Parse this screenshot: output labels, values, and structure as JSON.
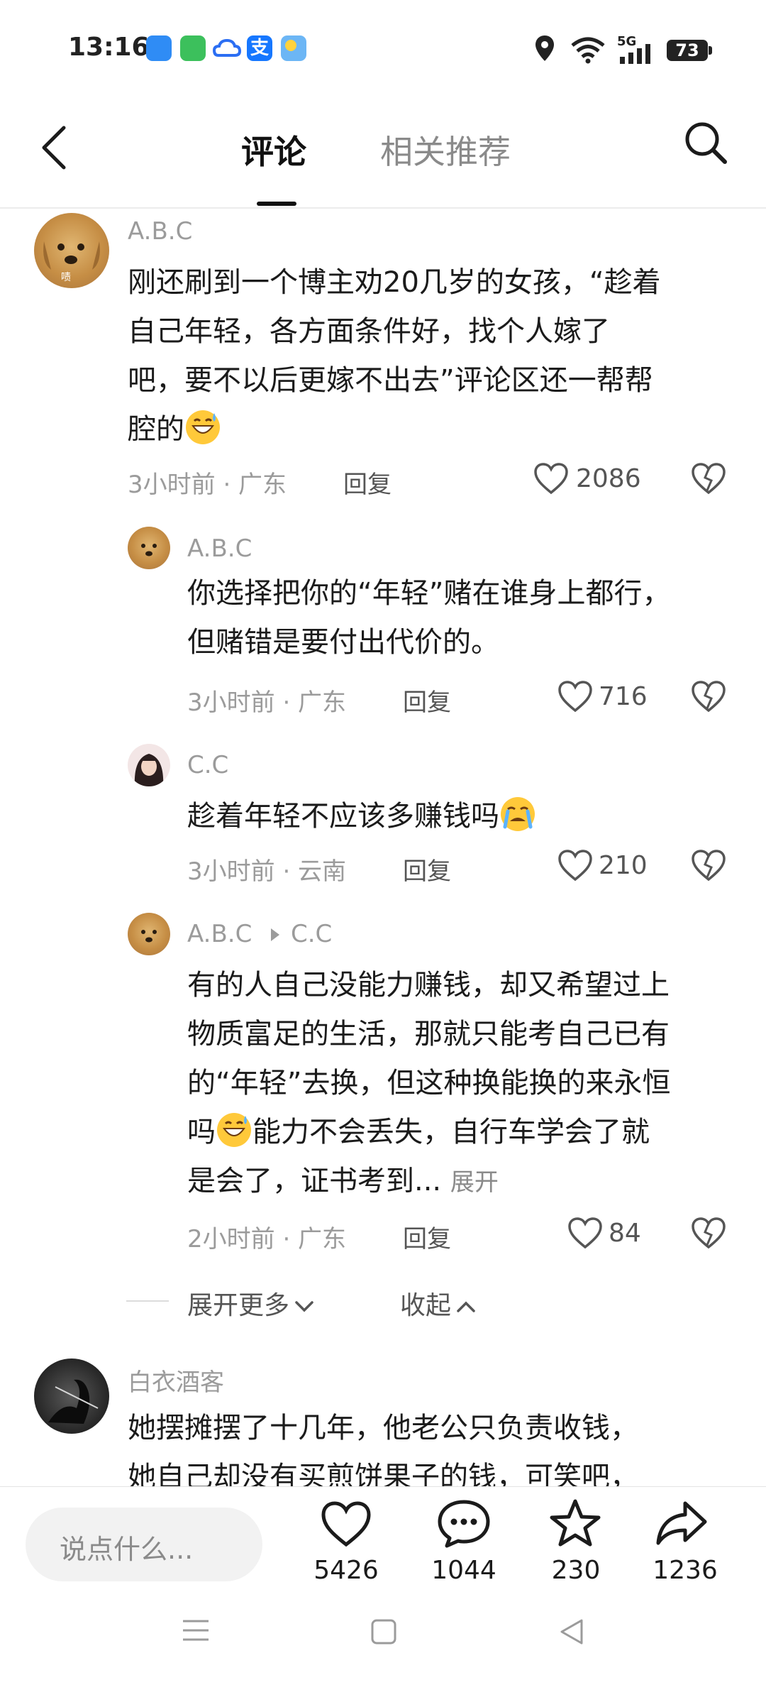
{
  "status_bar": {
    "time": "13:16",
    "network": "5G",
    "battery": "73"
  },
  "header": {
    "tabs": [
      {
        "label": "评论"
      },
      {
        "label": "相关推荐"
      }
    ]
  },
  "comments": [
    {
      "user": "A.B.C",
      "text_lines": [
        "刚还刷到一个博主劝20几岁的女孩，“趁着",
        "自己年轻，各方面条件好，找个人嫁了",
        "吧，要不以后更嫁不出去”评论区还一帮帮",
        "腔的"
      ],
      "meta": "3小时前 · 广东",
      "reply": "回复",
      "likes": "2086"
    },
    {
      "user": "A.B.C",
      "text_lines": [
        "你选择把你的“年轻”赌在谁身上都行，",
        "但赌错是要付出代价的。"
      ],
      "meta": "3小时前 · 广东",
      "reply": "回复",
      "likes": "716"
    },
    {
      "user": "C.C",
      "text_lines": [
        "趁着年轻不应该多赚钱吗"
      ],
      "meta": "3小时前 · 云南",
      "reply": "回复",
      "likes": "210"
    },
    {
      "user": "A.B.C",
      "reply_to": "C.C",
      "text_lines": [
        "有的人自己没能力赚钱，却又希望过上",
        "物质富足的生活，那就只能考自己已有",
        "的“年轻”去换，但这种换能换的来永恒",
        "吗",
        "能力不会丢失，自行车学会了就",
        "是会了，证书考到..."
      ],
      "expand": "展开",
      "meta": "2小时前 · 广东",
      "reply": "回复",
      "likes": "84"
    },
    {
      "user": "白衣酒客",
      "text_lines": [
        "她摆摊摆了十几年，他老公只负责收钱，",
        "她自己却没有买煎饼果子的钱，可笑吧，"
      ]
    }
  ],
  "thread_controls": {
    "expand_more": "展开更多",
    "collapse": "收起"
  },
  "bottom_bar": {
    "input_placeholder": "说点什么...",
    "like_count": "5426",
    "comment_count": "1044",
    "favorite_count": "230",
    "share_count": "1236"
  },
  "icons": [
    "back-icon",
    "search-icon",
    "heart-icon",
    "heart-broken-icon",
    "chat-bubble-icon",
    "star-icon",
    "share-arrow-icon",
    "location-icon",
    "wifi-icon",
    "signal-icon"
  ]
}
